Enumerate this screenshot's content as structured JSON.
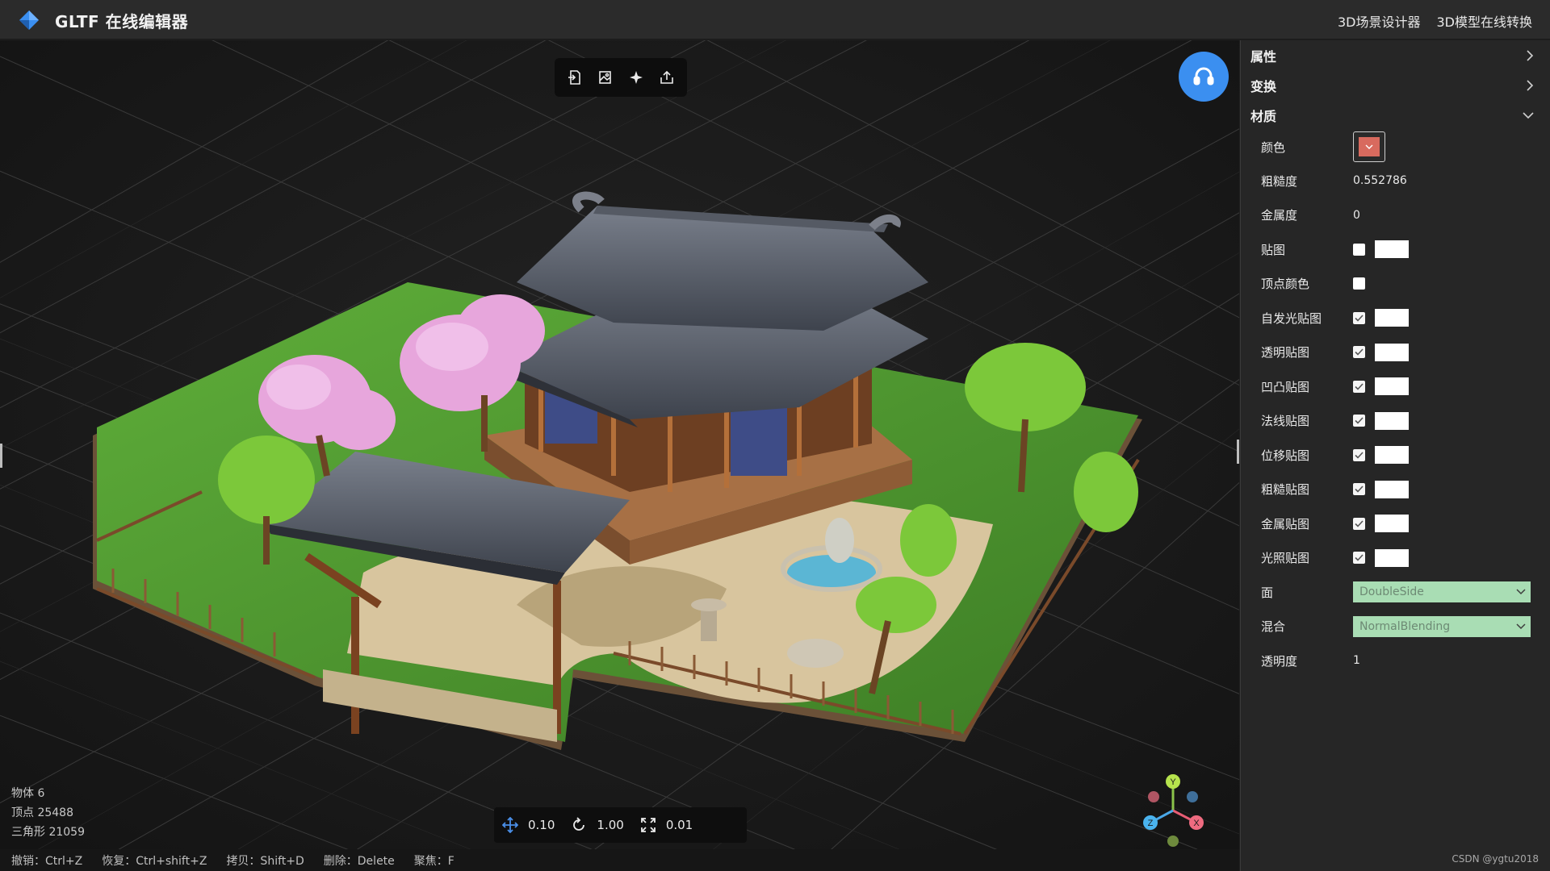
{
  "app": {
    "title": "GLTF 在线编辑器",
    "links": [
      "3D场景设计器",
      "3D模型在线转换"
    ]
  },
  "toolbar": {
    "icons": [
      "import-icon",
      "image-export-icon",
      "focus-icon",
      "export-icon"
    ]
  },
  "stats": {
    "objects": "物体 6",
    "vertices": "顶点 25488",
    "triangles": "三角形 21059"
  },
  "transform": {
    "translate": "0.10",
    "rotate": "1.00",
    "scale": "0.01"
  },
  "shortcuts": [
    "撤销：Ctrl+Z",
    "恢复：Ctrl+shift+Z",
    "拷贝：Shift+D",
    "删除：Delete",
    "聚焦：F"
  ],
  "panel": {
    "sections": {
      "properties": "属性",
      "transform": "变换",
      "material": "材质"
    },
    "material": {
      "color_label": "颜色",
      "color_value": "#d86a5e",
      "roughness_label": "粗糙度",
      "roughness_value": "0.552786",
      "metalness_label": "金属度",
      "metalness_value": "0",
      "maps": [
        {
          "label": "贴图",
          "checked": false,
          "has_box": true
        },
        {
          "label": "顶点颜色",
          "checked": false,
          "has_box": false
        },
        {
          "label": "自发光贴图",
          "checked": true,
          "has_box": true
        },
        {
          "label": "透明贴图",
          "checked": true,
          "has_box": true
        },
        {
          "label": "凹凸贴图",
          "checked": true,
          "has_box": true
        },
        {
          "label": "法线贴图",
          "checked": true,
          "has_box": true
        },
        {
          "label": "位移贴图",
          "checked": true,
          "has_box": true
        },
        {
          "label": "粗糙贴图",
          "checked": true,
          "has_box": true
        },
        {
          "label": "金属贴图",
          "checked": true,
          "has_box": true
        },
        {
          "label": "光照贴图",
          "checked": true,
          "has_box": true
        }
      ],
      "side_label": "面",
      "side_value": "DoubleSide",
      "blending_label": "混合",
      "blending_value": "NormalBlending",
      "opacity_label": "透明度",
      "opacity_value": "1"
    }
  },
  "credit": "CSDN @ygtu2018",
  "colors": {
    "accent": "#3b8ff0",
    "select_bg": "#a9ddb4"
  }
}
